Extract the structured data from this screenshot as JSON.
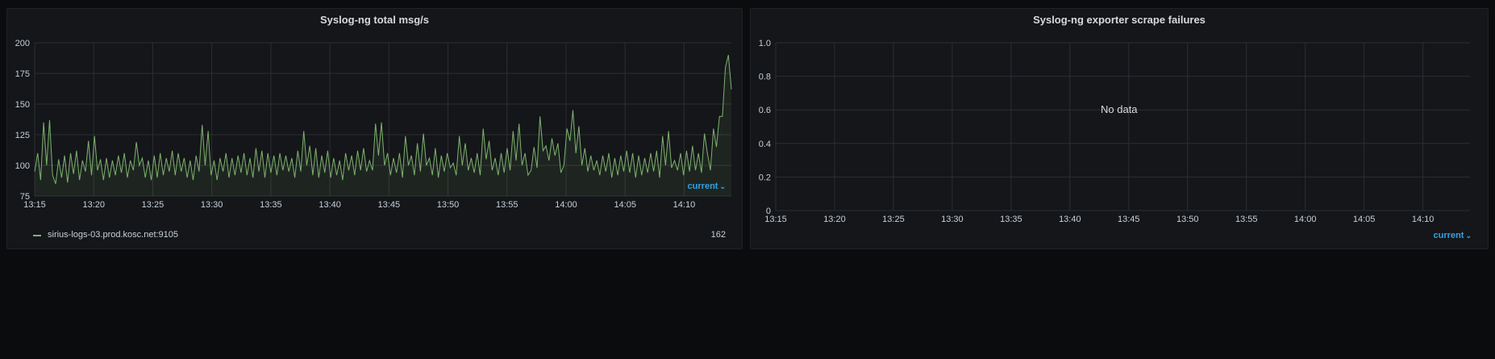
{
  "panels": [
    {
      "title": "Syslog-ng total msg/s",
      "legend_toggle": "current",
      "legend": [
        {
          "name": "sirius-logs-03.prod.kosc.net:9105",
          "value": "162",
          "color": "#7eb26d"
        }
      ]
    },
    {
      "title": "Syslog-ng exporter scrape failures",
      "legend_toggle": "current",
      "no_data": "No data"
    }
  ],
  "chart_data": [
    {
      "type": "line",
      "title": "Syslog-ng total msg/s",
      "x_ticks": [
        "13:15",
        "13:20",
        "13:25",
        "13:30",
        "13:35",
        "13:40",
        "13:45",
        "13:50",
        "13:55",
        "14:00",
        "14:05",
        "14:10"
      ],
      "y_ticks": [
        "75",
        "100",
        "125",
        "150",
        "175",
        "200"
      ],
      "ylim": [
        75,
        200
      ],
      "grid": true,
      "legend_position": "bottom",
      "series": [
        {
          "name": "sirius-logs-03.prod.kosc.net:9105",
          "color": "#7eb26d",
          "values": [
            95,
            110,
            88,
            135,
            100,
            137,
            92,
            85,
            105,
            90,
            108,
            86,
            110,
            93,
            112,
            88,
            104,
            95,
            120,
            92,
            124,
            96,
            105,
            88,
            106,
            90,
            104,
            92,
            108,
            94,
            110,
            90,
            104,
            96,
            119,
            100,
            106,
            90,
            104,
            88,
            108,
            90,
            110,
            92,
            106,
            95,
            112,
            92,
            110,
            95,
            106,
            90,
            104,
            88,
            108,
            95,
            133,
            100,
            128,
            92,
            104,
            88,
            106,
            95,
            110,
            90,
            106,
            92,
            108,
            94,
            110,
            92,
            106,
            90,
            114,
            95,
            112,
            90,
            110,
            94,
            108,
            92,
            110,
            96,
            108,
            95,
            106,
            90,
            112,
            95,
            128,
            100,
            116,
            92,
            114,
            90,
            108,
            94,
            112,
            90,
            106,
            92,
            104,
            88,
            110,
            96,
            108,
            92,
            112,
            96,
            114,
            95,
            104,
            96,
            134,
            108,
            135,
            100,
            110,
            92,
            106,
            94,
            110,
            90,
            124,
            100,
            108,
            92,
            118,
            95,
            126,
            100,
            106,
            92,
            114,
            90,
            108,
            95,
            110,
            98,
            102,
            92,
            124,
            100,
            118,
            96,
            106,
            94,
            110,
            92,
            130,
            105,
            120,
            96,
            106,
            92,
            110,
            94,
            114,
            96,
            128,
            104,
            134,
            100,
            110,
            92,
            96,
            115,
            98,
            140,
            112,
            116,
            104,
            122,
            108,
            118,
            94,
            100,
            130,
            120,
            145,
            110,
            132,
            100,
            114,
            95,
            108,
            96,
            104,
            92,
            108,
            95,
            110,
            90,
            106,
            92,
            108,
            95,
            112,
            94,
            110,
            90,
            108,
            92,
            106,
            94,
            110,
            95,
            112,
            90,
            124,
            100,
            128,
            98,
            104,
            96,
            110,
            92,
            112,
            95,
            116,
            96,
            110,
            94,
            126,
            110,
            96,
            130,
            115,
            140,
            140,
            180,
            190,
            162
          ]
        }
      ]
    },
    {
      "type": "line",
      "title": "Syslog-ng exporter scrape failures",
      "x_ticks": [
        "13:15",
        "13:20",
        "13:25",
        "13:30",
        "13:35",
        "13:40",
        "13:45",
        "13:50",
        "13:55",
        "14:00",
        "14:05",
        "14:10"
      ],
      "y_ticks": [
        "0",
        "0.2",
        "0.4",
        "0.6",
        "0.8",
        "1.0"
      ],
      "ylim": [
        0,
        1
      ],
      "grid": true,
      "series": []
    }
  ]
}
